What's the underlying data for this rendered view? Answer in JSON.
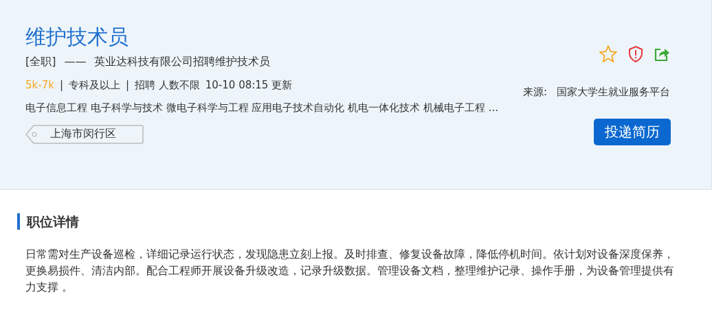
{
  "job": {
    "title": "维护技术员",
    "type": "[全职]",
    "dash": "——",
    "company": "英业达科技有限公司招聘维护技术员",
    "salary": "5k-7k",
    "meta": [
      "专科及以上",
      "招聘 人数不限"
    ],
    "separator": "|",
    "updated": "10-10 08:15 更新",
    "majors": "电子信息工程 电子科学与技术 微电子科学与工程 应用电子技术自动化 机电一体化技术 机械电子工程 ...",
    "location": "上海市闵行区",
    "source_label": "来源:",
    "source": "国家大学生就业服务平台",
    "apply_button": "投递简历"
  },
  "details": {
    "heading": "职位详情",
    "text": "日常需对生产设备巡检，详细记录运行状态，发现隐患立刻上报。及时排查、修复设备故障，降低停机时间。依计划对设备深度保养，更换易损件、清洁内部。配合工程师开展设备升级改造，记录升级数据。管理设备文档，整理维护记录、操作手册，为设备管理提供有力支撑 。"
  }
}
